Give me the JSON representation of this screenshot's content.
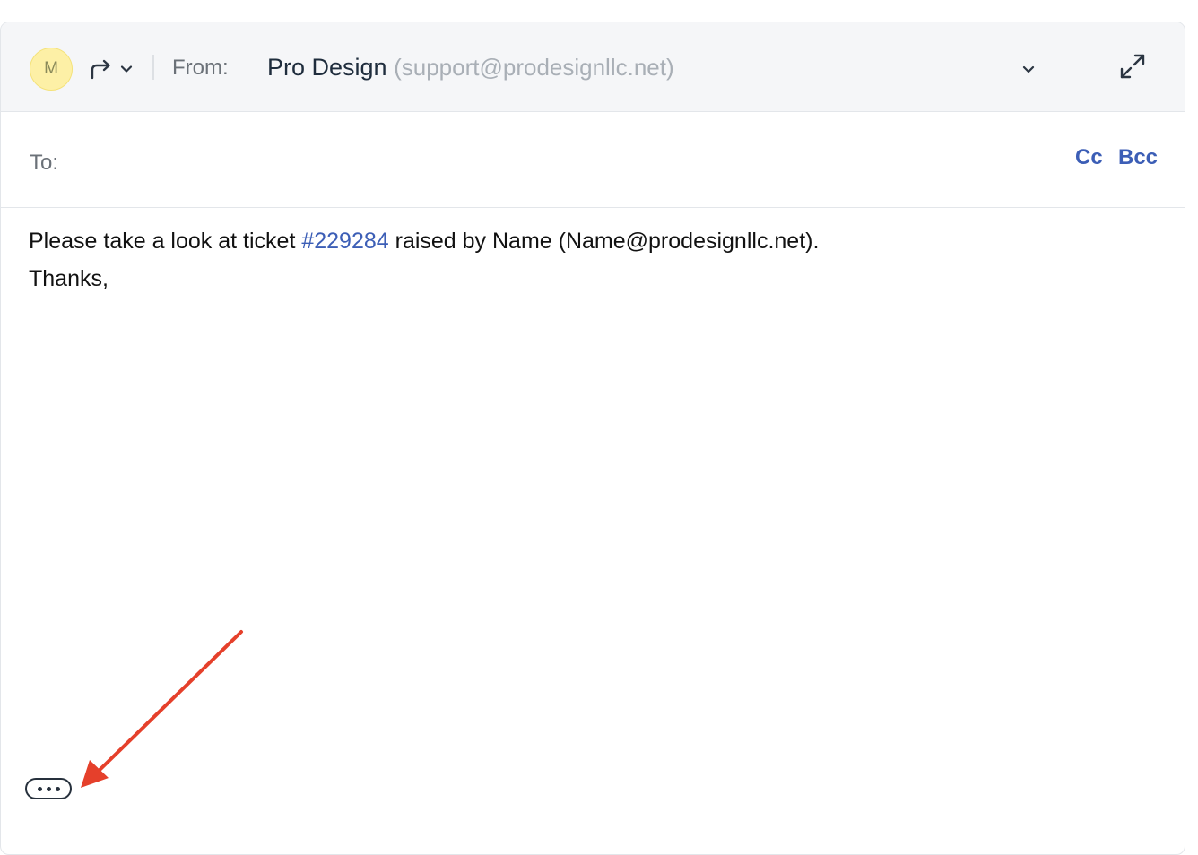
{
  "header": {
    "avatar_initial": "M",
    "reply_icon": "forward-arrow-icon",
    "from_label": "From:",
    "from_name": "Pro Design",
    "from_email": "(support@prodesignllc.net)"
  },
  "recipients": {
    "to_label": "To:",
    "to_value": "",
    "cc_label": "Cc",
    "bcc_label": "Bcc"
  },
  "body": {
    "line1_before": "Please take a look at ticket ",
    "ticket_link": "#229284",
    "line1_after": " raised by Name (Name@prodesignllc.net).",
    "line2": "Thanks,"
  },
  "footer": {
    "more_icon": "ellipsis-icon"
  },
  "colors": {
    "accent": "#3c5eb6",
    "header_bg": "#f5f6f8",
    "avatar_bg": "#fdf0a6",
    "annotation_arrow": "#e5402b"
  }
}
